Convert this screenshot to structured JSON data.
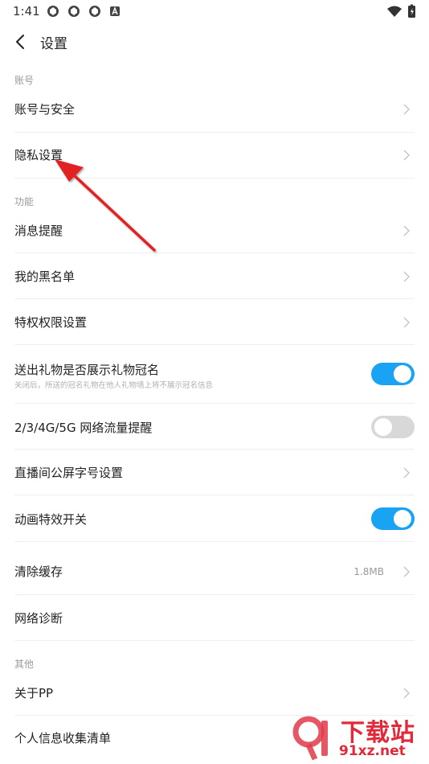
{
  "status": {
    "time": "1:41"
  },
  "header": {
    "title": "设置"
  },
  "sections": {
    "account": "账号",
    "features": "功能",
    "other": "其他"
  },
  "items": {
    "account_security": "账号与安全",
    "privacy": "隐私设置",
    "notifications": "消息提醒",
    "blacklist": "我的黑名单",
    "privilege": "特权权限设置",
    "gift_title": "送出礼物是否展示礼物冠名",
    "gift_title_desc": "关闭后，所送的冠名礼物在他人礼物墙上将不展示冠名信息",
    "traffic_alert": "2/3/4G/5G 网络流量提醒",
    "font_size": "直播间公屏字号设置",
    "animation": "动画特效开关",
    "clear_cache": "清除缓存",
    "cache_size": "1.8MB",
    "diagnosis": "网络诊断",
    "about": "关于PP",
    "personal_info": "个人信息收集清单"
  },
  "toggles": {
    "gift_title": true,
    "traffic_alert": false,
    "animation": true
  },
  "watermark": {
    "logo_text": "下载站",
    "url": "91xz.net"
  },
  "colors": {
    "toggle_on": "#1aa3f2",
    "toggle_off": "#d8d8d8",
    "annotation_arrow": "#e02020"
  }
}
